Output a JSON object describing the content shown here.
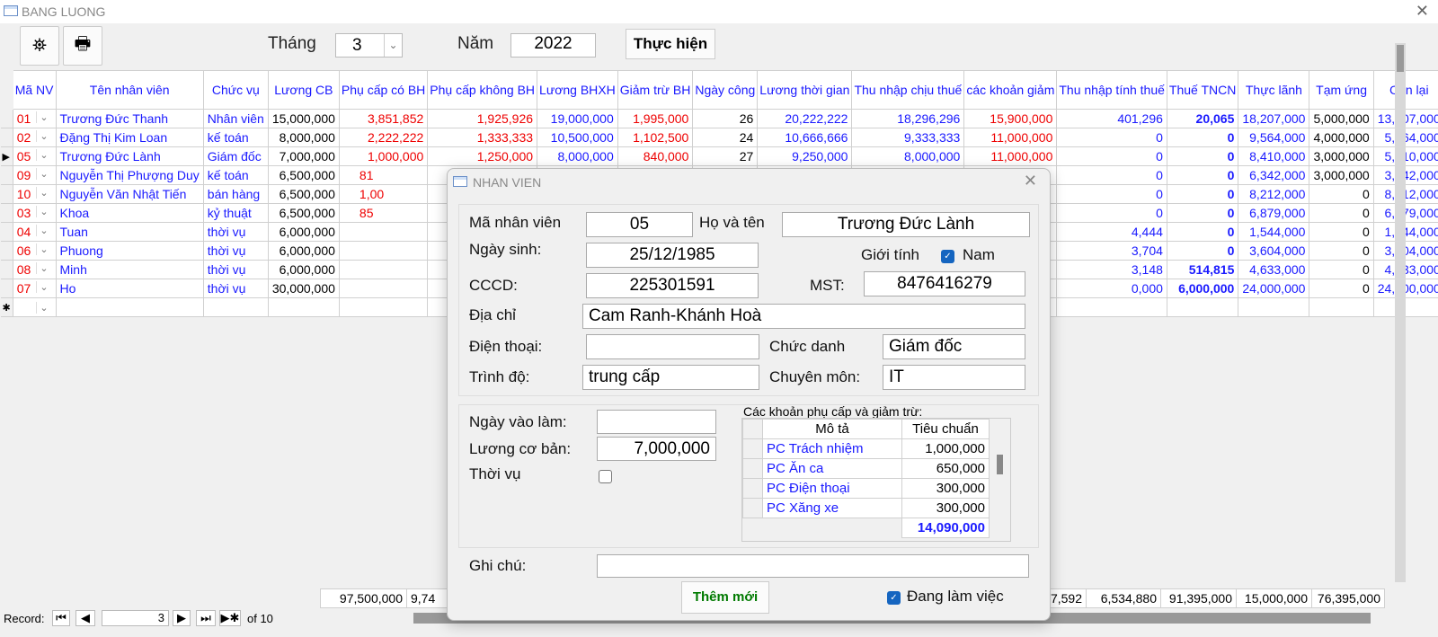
{
  "window": {
    "title": "BANG LUONG",
    "close": "✕"
  },
  "toolbar": {
    "find_icon": "binoculars-icon",
    "print_icon": "printer-icon",
    "month_label": "Tháng",
    "month_value": "3",
    "year_label": "Năm",
    "year_value": "2022",
    "run_label": "Thực hiện"
  },
  "colors": {
    "red": "#e00000",
    "blue": "#1a1aff"
  },
  "table": {
    "headers": [
      "Mã NV",
      "Tên nhân viên",
      "Chức vụ",
      "Lương CB",
      "Phụ cấp có BH",
      "Phụ cấp không BH",
      "Lương BHXH",
      "Giảm trừ BH",
      "Ngày công",
      "Lương thời gian",
      "Thu nhập chịu thuế",
      "các khoản giảm",
      "Thu nhập tính thuế",
      "Thuế TNCN",
      "Thực lãnh",
      "Tạm ứng",
      "Còn lại"
    ],
    "rows": [
      [
        "01",
        "Trương Đức Thanh",
        "Nhân viên",
        "15,000,000",
        "3,851,852",
        "1,925,926",
        "19,000,000",
        "1,995,000",
        "26",
        "20,222,222",
        "18,296,296",
        "15,900,000",
        "401,296",
        "20,065",
        "18,207,000",
        "5,000,000",
        "13,207,000"
      ],
      [
        "02",
        "Đặng Thị Kim Loan",
        "kế toán",
        "8,000,000",
        "2,222,222",
        "1,333,333",
        "10,500,000",
        "1,102,500",
        "24",
        "10,666,666",
        "9,333,333",
        "11,000,000",
        "0",
        "0",
        "9,564,000",
        "4,000,000",
        "5,564,000"
      ],
      [
        "05",
        "Trương Đức Lành",
        "Giám đốc",
        "7,000,000",
        "1,000,000",
        "1,250,000",
        "8,000,000",
        "840,000",
        "27",
        "9,250,000",
        "8,000,000",
        "11,000,000",
        "0",
        "0",
        "8,410,000",
        "3,000,000",
        "5,410,000"
      ],
      [
        "09",
        "Nguyễn Thị Phượng Duy",
        "kế toán",
        "6,500,000",
        "81",
        "",
        "",
        "",
        "",
        "",
        "",
        "",
        "0",
        "0",
        "6,342,000",
        "3,000,000",
        "3,342,000"
      ],
      [
        "10",
        "Nguyễn Văn Nhật Tiến",
        "bán hàng",
        "6,500,000",
        "1,00",
        "",
        "",
        "",
        "",
        "",
        "",
        "",
        "0",
        "0",
        "8,212,000",
        "0",
        "8,212,000"
      ],
      [
        "03",
        "Khoa",
        "kỷ thuật",
        "6,500,000",
        "85",
        "",
        "",
        "",
        "",
        "",
        "",
        "",
        "0",
        "0",
        "6,879,000",
        "0",
        "6,879,000"
      ],
      [
        "04",
        "Tuan",
        "thời vụ",
        "6,000,000",
        "",
        "",
        "",
        "",
        "",
        "",
        "",
        "",
        "4,444",
        "0",
        "1,544,000",
        "0",
        "1,544,000"
      ],
      [
        "06",
        "Phuong",
        "thời vụ",
        "6,000,000",
        "",
        "",
        "",
        "",
        "",
        "",
        "",
        "",
        "3,704",
        "0",
        "3,604,000",
        "0",
        "3,604,000"
      ],
      [
        "08",
        "Minh",
        "thời vụ",
        "6,000,000",
        "",
        "",
        "",
        "",
        "",
        "",
        "",
        "",
        "3,148",
        "514,815",
        "4,633,000",
        "0",
        "4,633,000"
      ],
      [
        "07",
        "Ho",
        "thời vụ",
        "30,000,000",
        "",
        "",
        "",
        "",
        "",
        "",
        "",
        "",
        "0,000",
        "6,000,000",
        "24,000,000",
        "0",
        "24,000,000"
      ]
    ],
    "current_row": 2,
    "new_row_marker": "✱",
    "totals": [
      "97,500,000",
      "9,74",
      "7,592",
      "6,534,880",
      "91,395,000",
      "15,000,000",
      "76,395,000"
    ]
  },
  "nav": {
    "label": "Record:",
    "current": "3",
    "of": "of 10"
  },
  "dialog": {
    "title": "NHAN VIEN",
    "ma_nv_label": "Mã nhân viên",
    "ma_nv": "05",
    "ho_ten_label": "Họ và tên",
    "ho_ten": "Trương Đức Lành",
    "ngay_sinh_label": "Ngày sinh:",
    "ngay_sinh": "25/12/1985",
    "gioi_tinh_label": "Giới tính",
    "gioi_tinh_option": "Nam",
    "gioi_tinh_checked": true,
    "cccd_label": "CCCD:",
    "cccd": "225301591",
    "mst_label": "MST:",
    "mst": "8476416279",
    "dia_chi_label": "Địa chỉ",
    "dia_chi": "Cam Ranh-Khánh Hoà",
    "dien_thoai_label": "Điện thoại:",
    "dien_thoai": "",
    "chuc_danh_label": "Chức danh",
    "chuc_danh": "Giám đốc",
    "trinh_do_label": "Trình độ:",
    "trinh_do": "trung cấp",
    "chuyen_mon_label": "Chuyên môn:",
    "chuyen_mon": "IT",
    "ngay_vao_lam_label": "Ngày vào làm:",
    "ngay_vao_lam": "",
    "luong_cb_label": "Lương cơ bản:",
    "luong_cb": "7,000,000",
    "thoi_vu_label": "Thời vụ",
    "thoi_vu_checked": false,
    "allow_title": "Các khoản phụ cấp và giảm trừ:",
    "allow_headers": [
      "Mô tả",
      "Tiêu chuẩn"
    ],
    "allowances": [
      [
        "PC Trách nhiệm",
        "1,000,000"
      ],
      [
        "PC Ăn ca",
        "650,000"
      ],
      [
        "PC Điện thoại",
        "300,000"
      ],
      [
        "PC Xăng xe",
        "300,000"
      ]
    ],
    "allow_total": "14,090,000",
    "ghi_chu_label": "Ghi chú:",
    "ghi_chu": "",
    "add_label": "Thêm mới",
    "active_label": "Đang làm việc",
    "active_checked": true
  }
}
